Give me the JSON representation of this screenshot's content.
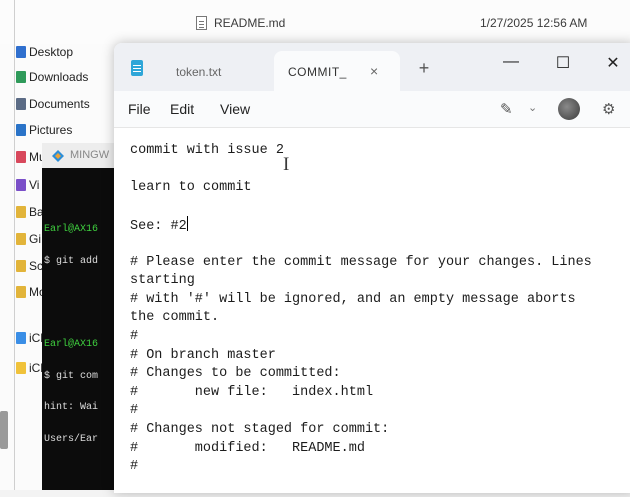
{
  "explorer": {
    "file": {
      "name": "README.md",
      "date": "1/27/2025 12:56 AM"
    },
    "sidebar": [
      {
        "label": "Desktop",
        "color": "#2f6fce"
      },
      {
        "label": "Downloads",
        "color": "#2f9a5a"
      },
      {
        "label": "Documents",
        "color": "#5b6b85"
      },
      {
        "label": "Pictures",
        "color": "#2a73c8"
      },
      {
        "label": "Mu",
        "color": "#d8485c"
      },
      {
        "label": "Vi",
        "color": "#7a4fc8"
      },
      {
        "label": "Ba",
        "color": "#e2b43a"
      },
      {
        "label": "Gi",
        "color": "#e2b43a"
      },
      {
        "label": "Sc",
        "color": "#e2b43a"
      },
      {
        "label": "Mo",
        "color": "#e2b43a"
      },
      {
        "label": "iCl",
        "color": "#3a8ee6"
      },
      {
        "label": "iCl",
        "color": "#f0c23a"
      }
    ]
  },
  "terminal": {
    "title": "MINGW",
    "blocks": [
      {
        "prompt": "Earl@AX16",
        "cmd": "$ git add"
      },
      {
        "prompt": "Earl@AX16",
        "cmd": "$ git com",
        "extra": [
          "hint: Wai",
          "Users/Ear"
        ]
      }
    ]
  },
  "notepad": {
    "tabs": {
      "inactive": "token.txt",
      "active": "COMMIT_",
      "close": "×",
      "new": "+"
    },
    "controls": {
      "minimize": "—",
      "maximize": "☐",
      "close": "✕"
    },
    "menu": {
      "file": "File",
      "edit": "Edit",
      "view": "View"
    },
    "editor": {
      "line1": "commit with issue 2",
      "line2": "learn to commit",
      "line3": "See: #2",
      "line4": "# Please enter the commit message for your changes. Lines",
      "line5": "starting",
      "line6": "# with '#' will be ignored, and an empty message aborts",
      "line7": "the commit.",
      "line8": "#",
      "line9": "# On branch master",
      "line10": "# Changes to be committed:",
      "line11": "#       new file:   index.html",
      "line12": "#",
      "line13": "# Changes not staged for commit:",
      "line14": "#       modified:   README.md",
      "line15": "#"
    }
  }
}
